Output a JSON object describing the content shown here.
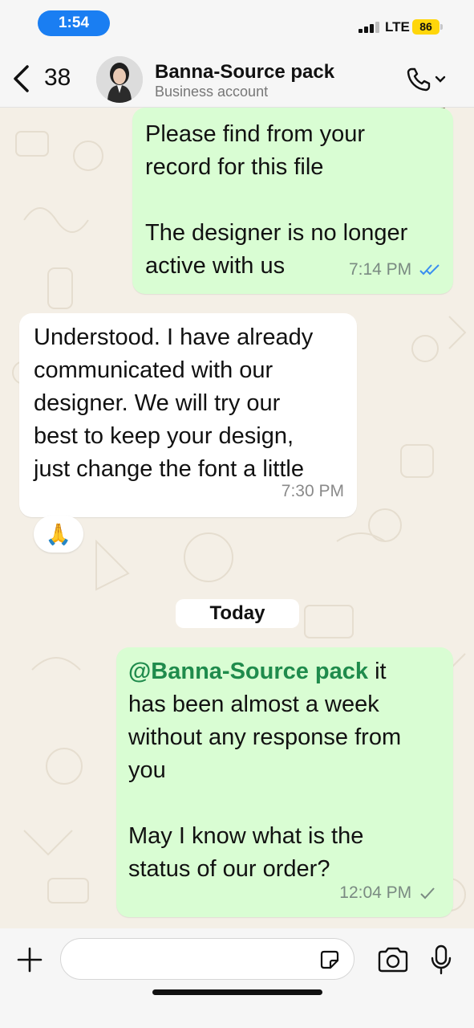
{
  "status_bar": {
    "time": "1:54",
    "network": "LTE",
    "battery": "86"
  },
  "header": {
    "back_count": "38",
    "contact_name": "Banna-Source pack",
    "contact_subtitle": "Business account"
  },
  "messages": [
    {
      "direction": "outgoing",
      "lines": [
        "Please find from your",
        "record for this file",
        "",
        "The designer is no longer",
        "active with us"
      ],
      "time": "7:14 PM",
      "status": "read"
    },
    {
      "direction": "incoming",
      "lines": [
        "Understood. I have already",
        "communicated with our",
        "designer. We will try our",
        "best to keep your design,",
        "just change the font a little"
      ],
      "time": "7:30 PM",
      "reaction": "🙏"
    },
    {
      "direction": "outgoing",
      "mention": "@Banna-Source pack",
      "lines": [
        " it",
        "has been almost a week",
        "without any response from",
        "you",
        "",
        "May I know what is the",
        "status of our order?"
      ],
      "time": "12:04 PM",
      "status": "sent"
    }
  ],
  "day_separator": "Today",
  "input": {
    "placeholder": ""
  },
  "colors": {
    "outgoing_bubble": "#d9fdd3",
    "incoming_bubble": "#ffffff",
    "read_ticks": "#3a8ef0",
    "mention": "#1f8b4c",
    "time_pill": "#1a7ef2"
  }
}
